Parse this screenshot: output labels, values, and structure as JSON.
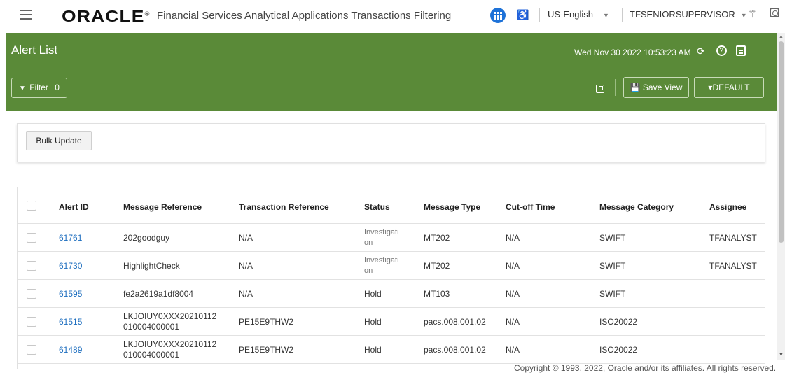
{
  "header": {
    "logo": "ORACLE",
    "app_title": "Financial Services Analytical Applications Transactions Filtering",
    "language": "US-English",
    "user": "TFSENIORSUPERVISOR"
  },
  "band": {
    "title": "Alert List",
    "datetime": "Wed Nov 30 2022 10:53:23 AM",
    "filter_label": "Filter",
    "filter_count": "0",
    "save_view_label": "Save View",
    "default_label": "DEFAULT"
  },
  "bulk": {
    "button_label": "Bulk Update"
  },
  "table": {
    "columns": [
      "Alert ID",
      "Message Reference",
      "Transaction Reference",
      "Status",
      "Message Type",
      "Cut-off Time",
      "Message Category",
      "Assignee"
    ],
    "rows": [
      {
        "alert_id": "61761",
        "msg_ref": "202goodguy",
        "trx_ref": "N/A",
        "status": "Investigati\non",
        "msg_type": "MT202",
        "cutoff": "N/A",
        "category": "SWIFT",
        "assignee": "TFANALYST"
      },
      {
        "alert_id": "61730",
        "msg_ref": "HighlightCheck",
        "trx_ref": "N/A",
        "status": "Investigati\non",
        "msg_type": "MT202",
        "cutoff": "N/A",
        "category": "SWIFT",
        "assignee": "TFANALYST"
      },
      {
        "alert_id": "61595",
        "msg_ref": "fe2a2619a1df8004",
        "trx_ref": "N/A",
        "status": "Hold",
        "msg_type": "MT103",
        "cutoff": "N/A",
        "category": "SWIFT",
        "assignee": ""
      },
      {
        "alert_id": "61515",
        "msg_ref": "LKJOIUY0XXX20210112\n010004000001",
        "trx_ref": "PE15E9THW2",
        "status": "Hold",
        "msg_type": "pacs.008.001.02",
        "cutoff": "N/A",
        "category": "ISO20022",
        "assignee": ""
      },
      {
        "alert_id": "61489",
        "msg_ref": "LKJOIUY0XXX20210112\n010004000001",
        "trx_ref": "PE15E9THW2",
        "status": "Hold",
        "msg_type": "pacs.008.001.02",
        "cutoff": "N/A",
        "category": "ISO20022",
        "assignee": ""
      }
    ]
  },
  "footer": {
    "copyright": "Copyright © 1993, 2022, Oracle and/or its affiliates. All rights reserved."
  },
  "colors": {
    "band_green": "#5a8a38",
    "link_blue": "#1f6fbf",
    "apps_blue": "#1e72d8"
  }
}
